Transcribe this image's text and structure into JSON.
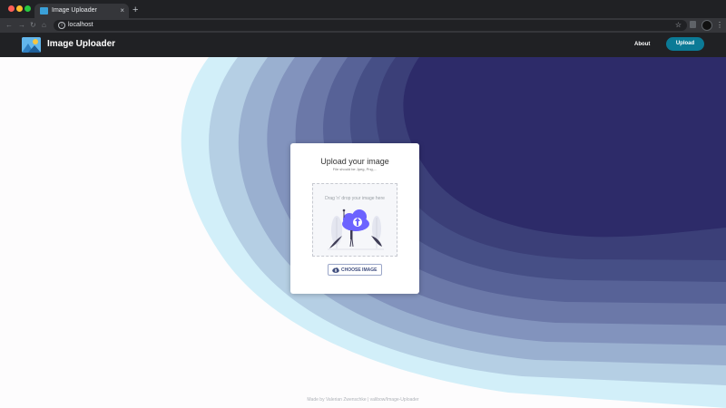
{
  "browser": {
    "tab_title": "Image Uploader",
    "tab_close": "×",
    "new_tab": "+",
    "url": "localhost",
    "nav": {
      "back": "←",
      "forward": "→",
      "reload": "↻",
      "home": "⌂"
    },
    "star": "☆",
    "menu": "⋮",
    "info": "i"
  },
  "app": {
    "brand": "Image Uploader",
    "nav": {
      "about": "About",
      "upload": "Upload"
    }
  },
  "upload_card": {
    "title": "Upload your image",
    "subtitle": "File should be Jpeg, Png,...",
    "dropzone_text": "Drag 'n' drop your image here",
    "choose_button": "CHOOSE IMAGE"
  },
  "footer": "Made by Valerian Zwenschke | valibow/Image-Uploader",
  "colors": {
    "accent": "#0b7a96",
    "wave_dark": "#2d2b69",
    "wave_light": "#d0eef8",
    "illustration": "#6c63ff"
  },
  "icons": {
    "logo": "image-icon",
    "choose": "cloud-upload-icon",
    "illustration": "cloud-upload-illustration"
  }
}
